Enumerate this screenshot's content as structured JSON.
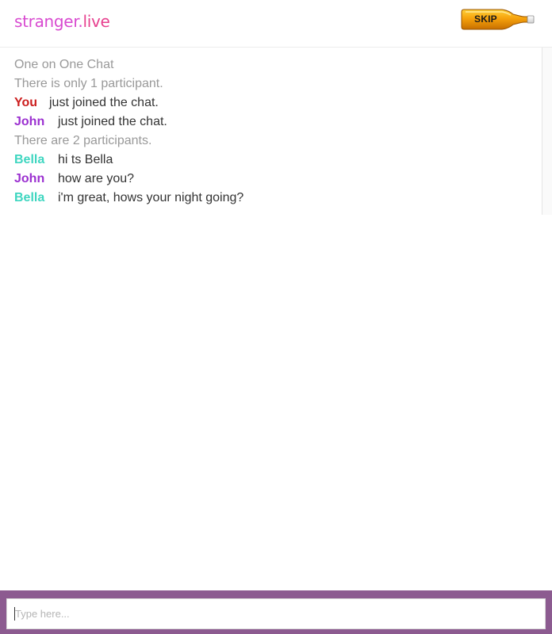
{
  "header": {
    "logo_part1": "stranger",
    "logo_dot": ".",
    "logo_part2": "live",
    "skip_label": "SKIP"
  },
  "chat": {
    "title": "One on One Chat",
    "system_1": "There is only 1 participant.",
    "events": [
      {
        "who": "You",
        "text": "just joined the chat."
      },
      {
        "who": "John",
        "text": "just joined the chat."
      }
    ],
    "system_2": "There are 2 participants.",
    "messages": [
      {
        "who": "Bella",
        "text": "hi ts Bella"
      },
      {
        "who": "John",
        "text": "how are you?"
      },
      {
        "who": "Bella",
        "text": "i'm great, hows your night going?"
      }
    ]
  },
  "input": {
    "placeholder": "Type here...",
    "value": ""
  },
  "colors": {
    "logo_pink": "#d84ad0",
    "you": "#cc1f1f",
    "john": "#9b30d0",
    "bella": "#3fd6c0",
    "footer": "#8c5b90",
    "skip_bottle": "#f6a20c"
  },
  "icons": {
    "skip": "beer-bottle-icon"
  }
}
